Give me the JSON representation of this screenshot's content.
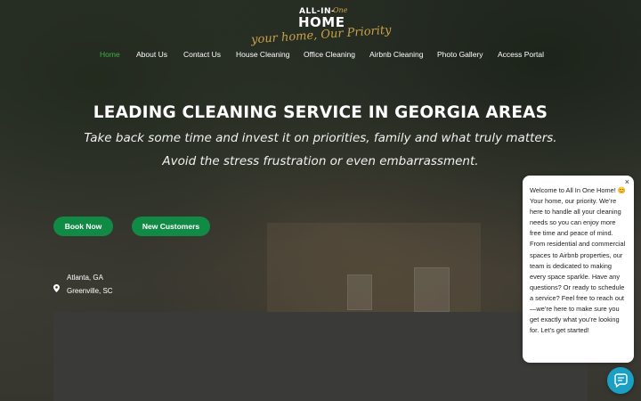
{
  "brand": {
    "logo_top": "ALL-IN-",
    "logo_top_script": "One",
    "logo_main": "HOME",
    "tagline": "your home, Our Priority"
  },
  "nav": {
    "items": [
      {
        "label": "Home",
        "active": true
      },
      {
        "label": "About Us",
        "active": false
      },
      {
        "label": "Contact Us",
        "active": false
      },
      {
        "label": "House Cleaning",
        "active": false
      },
      {
        "label": "Office Cleaning",
        "active": false
      },
      {
        "label": "Airbnb Cleaning",
        "active": false
      },
      {
        "label": "Photo Gallery",
        "active": false
      },
      {
        "label": "Access Portal",
        "active": false
      }
    ]
  },
  "hero": {
    "headline": "LEADING CLEANING SERVICE IN GEORGIA AREAS",
    "subline_1": "Take back some time and invest it on priorities, family and what truly matters.",
    "subline_2": "Avoid the stress frustration or even embarrassment.",
    "buttons": {
      "book_now": "Book Now",
      "new_customers": "New Customers"
    },
    "locations": [
      "Atlanta, GA",
      "Greenville, SC"
    ]
  },
  "chat": {
    "message": "Welcome to All In One Home! 😊 Your home, our priority. We’re here to handle all your cleaning needs so you can enjoy more free time and peace of mind. From residential and commercial spaces to Airbnb properties, our team is dedicated to making every space sparkle. Have any questions? Or ready to schedule a service? Feel free to reach out—we’re here to make sure you get exactly what you’re looking for. Let’s get started!",
    "close_glyph": "×"
  },
  "colors": {
    "accent_green": "#118a45",
    "active_nav": "#3fae49",
    "logo_gold": "#c9a24a",
    "chat_launcher": "#1b9fc2"
  },
  "icons": {
    "location": "map-pin-icon",
    "chat": "chat-icon",
    "close": "close-icon"
  }
}
